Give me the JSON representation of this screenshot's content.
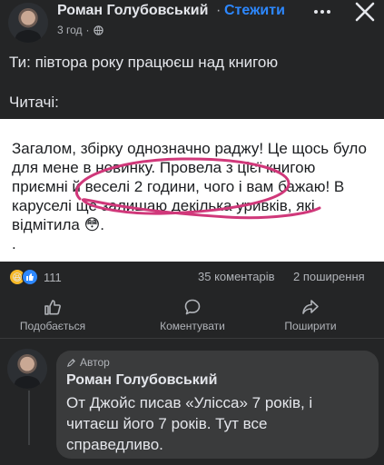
{
  "post": {
    "author": "Роман Голубовський",
    "dot": "·",
    "follow_label": "Стежити",
    "time": "3 год",
    "meta_dot": "·",
    "privacy_icon": "globe-icon",
    "text": "Ти: півтора року працюєш над книгою\n\nЧитачі:"
  },
  "image": {
    "text": "Загалом, збірку однозначно раджу! Це щось було для мене в новинку. Провела з цієї книгою приємні й веселі 2 години, чого і вам бажаю! В каруселі ще залишаю декілька уривків, які відмітила 😳.\n.",
    "scribble_color": "#d0387a"
  },
  "stats": {
    "reaction_count": "111",
    "comments": "35 коментарів",
    "shares": "2 поширення"
  },
  "actions": {
    "like": "Подобається",
    "comment": "Коментувати",
    "share": "Поширити"
  },
  "comment": {
    "badge": "Автор",
    "author": "Роман Голубовський",
    "text": "От Джойс писав «Улісса» 7 років, і читаєш його 7 років. Тут все справедливо."
  },
  "colors": {
    "background": "#242526",
    "accent": "#2d88ff",
    "bubble": "#3a3b3c"
  }
}
